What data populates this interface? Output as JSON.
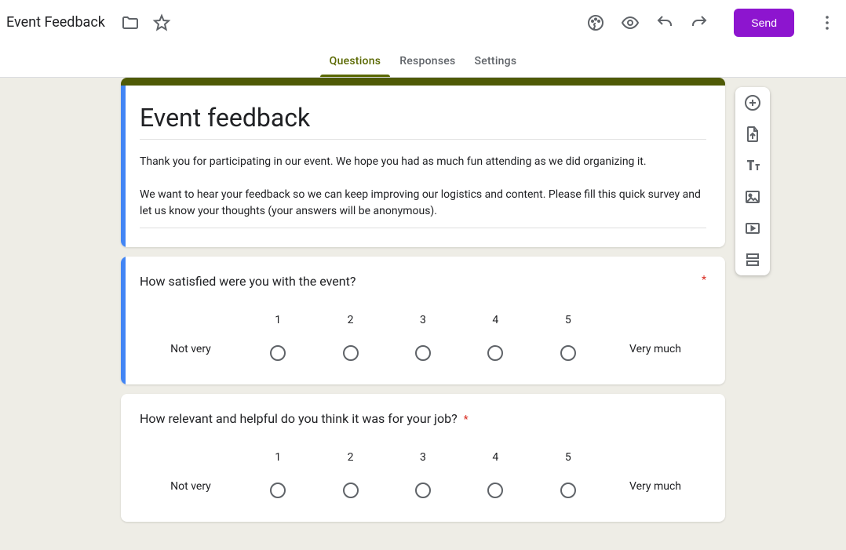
{
  "header": {
    "doc_title": "Event Feedback",
    "send_label": "Send"
  },
  "tabs": {
    "questions": "Questions",
    "responses": "Responses",
    "settings": "Settings"
  },
  "form": {
    "title": "Event feedback",
    "description": "Thank you for participating in our event. We hope you had as much fun attending as we did organizing it.\n\nWe want to hear your feedback so we can keep improving our logistics and content. Please fill this quick survey and let us know your thoughts (your answers will be anonymous)."
  },
  "questions": [
    {
      "title": "How satisfied were you with the event?",
      "required": true,
      "low_label": "Not very",
      "high_label": "Very much",
      "scale": [
        "1",
        "2",
        "3",
        "4",
        "5"
      ]
    },
    {
      "title": "How relevant and helpful do you think it was for your job?",
      "required": true,
      "low_label": "Not very",
      "high_label": "Very much",
      "scale": [
        "1",
        "2",
        "3",
        "4",
        "5"
      ]
    }
  ],
  "colors": {
    "accent": "#5a6800",
    "theme_header": "#4f5a06",
    "send_bg": "#8d15cf",
    "canvas_bg": "#eeede6"
  }
}
